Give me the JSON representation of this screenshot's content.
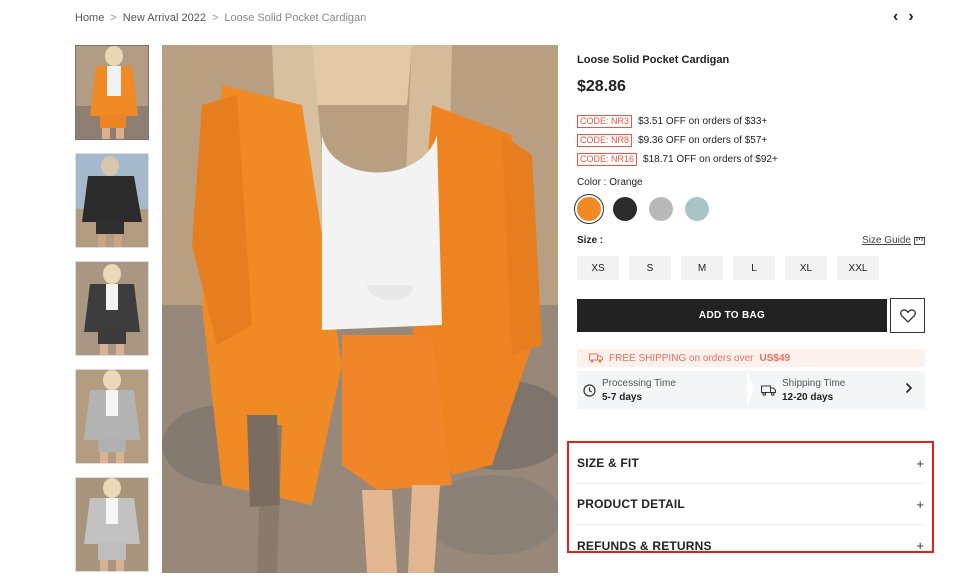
{
  "breadcrumb": {
    "home": "Home",
    "category": "New Arrival 2022",
    "current": "Loose Solid Pocket Cardigan",
    "sep": ">"
  },
  "nav": {
    "prev": "‹",
    "next": "›"
  },
  "product": {
    "title": "Loose Solid Pocket Cardigan",
    "price": "$28.86",
    "codes": [
      {
        "code": "CODE: NR3",
        "text": "$3.51 OFF on orders of $33+"
      },
      {
        "code": "CODE: NR8",
        "text": "$9.36 OFF on orders of $57+"
      },
      {
        "code": "CODE: NR16",
        "text": "$18.71 OFF on orders of $92+"
      }
    ],
    "color_label": "Color : Orange",
    "colors": [
      "#f08a24",
      "#2b2b2b",
      "#b8b8b8",
      "#a9c4c6"
    ],
    "size_label": "Size :",
    "size_guide": "Size Guide",
    "sizes": [
      "XS",
      "S",
      "M",
      "L",
      "XL",
      "XXL"
    ],
    "add_to_bag": "ADD TO BAG"
  },
  "shipping": {
    "banner_prefix": "FREE SHIPPING on orders over",
    "banner_amount": "US$49",
    "processing_label": "Processing Time",
    "processing_value": "5-7 days",
    "shipping_label": "Shipping Time",
    "shipping_value": "12-20 days"
  },
  "accordion": [
    "SIZE & FIT",
    "PRODUCT DETAIL",
    "REFUNDS & RETURNS"
  ]
}
